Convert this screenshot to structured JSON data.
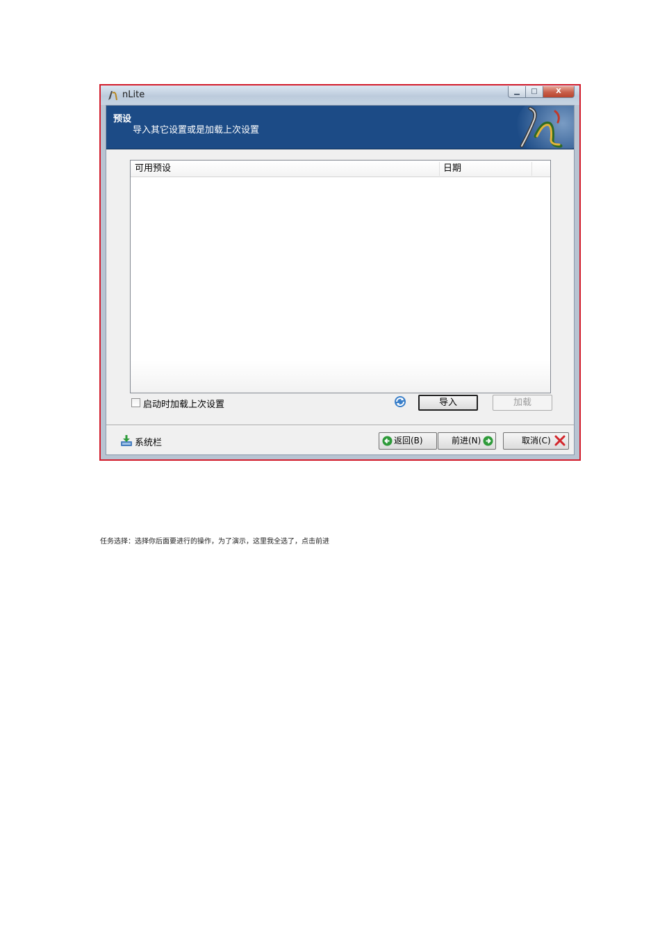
{
  "window": {
    "title": "nLite",
    "minimize_icon": "minimize-icon",
    "maximize_icon": "maximize-icon",
    "close_label": "X"
  },
  "header": {
    "title": "预设",
    "subtitle": "导入其它设置或是加载上次设置",
    "logo_icon": "nlite-logo-icon"
  },
  "presets_list": {
    "columns": [
      "可用预设",
      "日期"
    ],
    "rows": []
  },
  "options": {
    "load_last_on_start_label": "启动时加载上次设置",
    "load_last_on_start_checked": false
  },
  "buttons": {
    "refresh_icon": "refresh-icon",
    "import_label": "导入",
    "load_label": "加载",
    "load_enabled": false
  },
  "footer": {
    "tray_icon": "tray-download-icon",
    "tray_label": "系统栏",
    "back_label": "返回(B)",
    "next_label": "前进(N)",
    "cancel_label": "取消(C)"
  },
  "caption": "任务选择：选择你后面要进行的操作，为了演示，这里我全选了，点击前进",
  "colors": {
    "highlight_border": "#d21a2a",
    "header_bg": "#1c4b86",
    "nav_icon_green": "#2e9b3a",
    "cancel_icon_red": "#d3262b"
  }
}
